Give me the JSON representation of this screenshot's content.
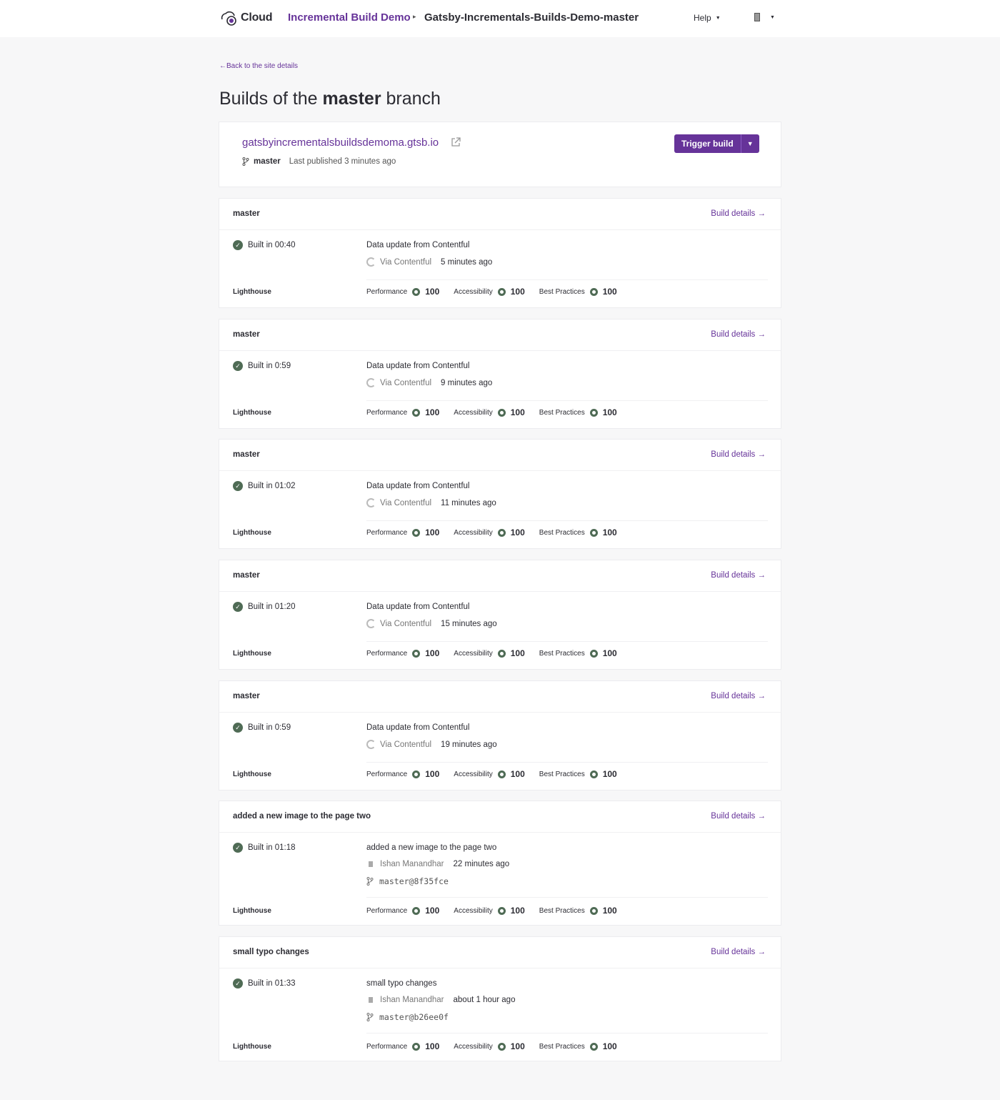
{
  "topbar": {
    "logo_text": "Cloud",
    "org": "Incremental Build Demo",
    "site": "Gatsby-Incrementals-Builds-Demo-master",
    "help": "Help"
  },
  "back_link": "←Back to the site details",
  "title": {
    "prefix": "Builds of the",
    "branch": "master",
    "suffix": "branch"
  },
  "site": {
    "url": "gatsbyincrementalsbuildsdemoma.gtsb.io",
    "branch": "master",
    "published": "Last published 3 minutes ago",
    "trigger_label": "Trigger build"
  },
  "lighthouse_label": "Lighthouse",
  "details_label": "Build details →",
  "score_labels": {
    "performance": "Performance",
    "accessibility": "Accessibility",
    "best_practices": "Best Practices"
  },
  "builds": [
    {
      "title": "master",
      "built": "Built in 00:40",
      "message": "Data update from Contentful",
      "via": "Via Contentful",
      "time": "5 minutes ago",
      "commit": "",
      "performance": "100",
      "accessibility": "100",
      "best_practices": "100"
    },
    {
      "title": "master",
      "built": "Built in 0:59",
      "message": "Data update from Contentful",
      "via": "Via Contentful",
      "time": "9 minutes ago",
      "commit": "",
      "performance": "100",
      "accessibility": "100",
      "best_practices": "100"
    },
    {
      "title": "master",
      "built": "Built in 01:02",
      "message": "Data update from Contentful",
      "via": "Via Contentful",
      "time": "11 minutes ago",
      "commit": "",
      "performance": "100",
      "accessibility": "100",
      "best_practices": "100"
    },
    {
      "title": "master",
      "built": "Built in 01:20",
      "message": "Data update from Contentful",
      "via": "Via Contentful",
      "time": "15 minutes ago",
      "commit": "",
      "performance": "100",
      "accessibility": "100",
      "best_practices": "100"
    },
    {
      "title": "master",
      "built": "Built in 0:59",
      "message": "Data update from Contentful",
      "via": "Via Contentful",
      "time": "19 minutes ago",
      "commit": "",
      "performance": "100",
      "accessibility": "100",
      "best_practices": "100"
    },
    {
      "title": "added a new image to the page two",
      "built": "Built in 01:18",
      "message": "added a new image to the page two",
      "via": "Ishan Manandhar",
      "time": "22 minutes ago",
      "commit": "master@8f35fce",
      "performance": "100",
      "accessibility": "100",
      "best_practices": "100"
    },
    {
      "title": "small typo changes",
      "built": "Built in 01:33",
      "message": "small typo changes",
      "via": "Ishan Manandhar",
      "time": "about 1 hour ago",
      "commit": "master@b26ee0f",
      "performance": "100",
      "accessibility": "100",
      "best_practices": "100"
    }
  ],
  "colors": {
    "accent": "#663399",
    "success": "#4f6b55",
    "background": "#f7f7f8"
  }
}
